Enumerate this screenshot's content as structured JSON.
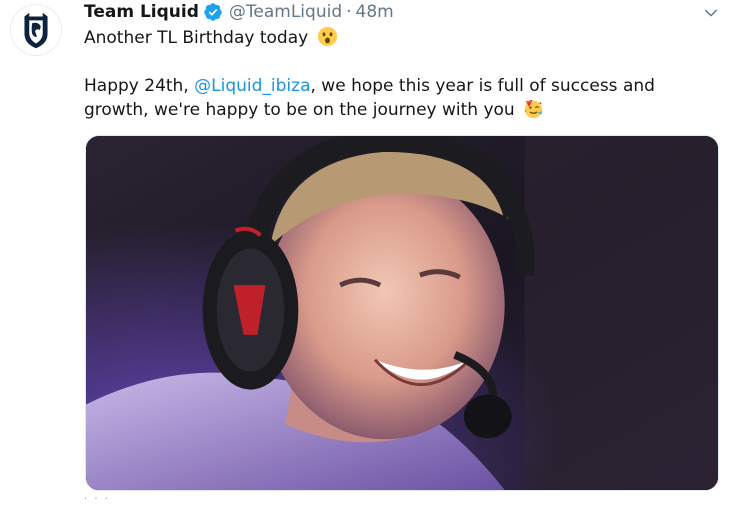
{
  "tweet": {
    "display_name": "Team Liquid",
    "handle": "@TeamLiquid",
    "separator": "·",
    "timestamp": "48m",
    "verified": true,
    "avatar_icon": "team-liquid-horse-logo",
    "text_line_1": "Another TL Birthday today",
    "text_line_1_emoji": "astonished-face-emoji",
    "text_line_2_before": "Happy 24th, ",
    "mention": "@Liquid_ibiza",
    "text_line_2_after": ", we hope this year is full of success and",
    "text_line_3": "growth, we're happy to be on the journey with you",
    "text_line_3_emoji": "partying-face-emoji",
    "media_icon": "photo-of-player-with-headset",
    "more_indicator": "· · ·"
  },
  "colors": {
    "accent": "#1b95e0",
    "verified": "#1da1f2",
    "secondary_text": "#657786",
    "text": "#14171a"
  }
}
